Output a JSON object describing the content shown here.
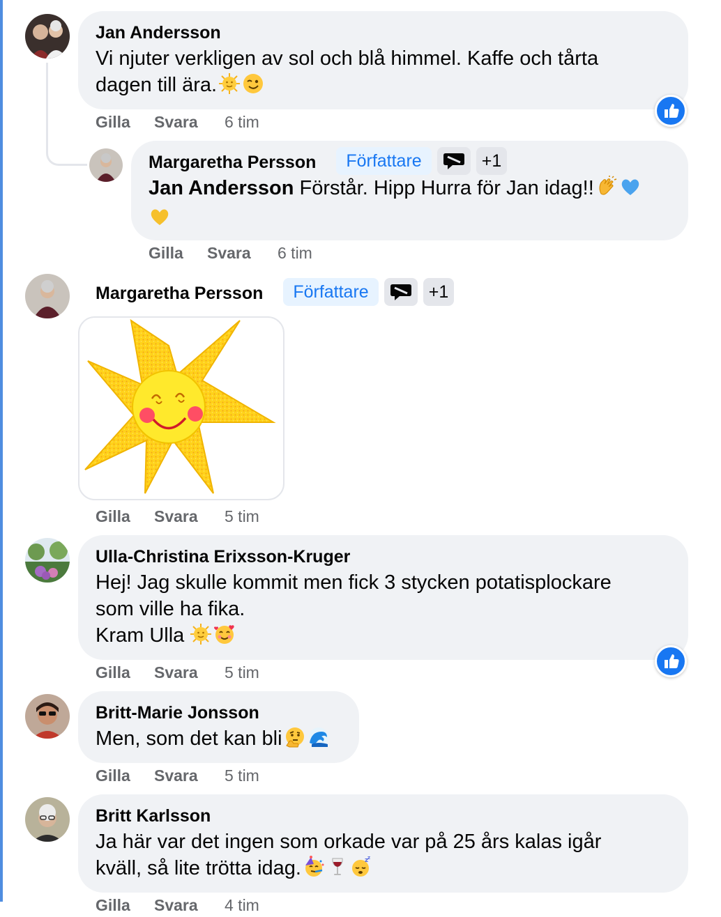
{
  "comments": [
    {
      "author": "Jan Andersson",
      "lines": [
        "Vi njuter verkligen av sol och blå himmel. Kaffe och tårta",
        "dagen till ära."
      ],
      "emoji_names": [
        "sun-face-emoji",
        "winking-face-emoji"
      ],
      "actions": {
        "like": "Gilla",
        "reply": "Svara",
        "time": "6 tim"
      },
      "reaction": "like"
    },
    {
      "author": "Margaretha Persson",
      "author_badge": "Författare",
      "extra_badge_count": "+1",
      "mention": "Jan Andersson",
      "lines": [
        " Förstår. Hipp Hurra för Jan idag!!"
      ],
      "emoji_names": [
        "clapping-hands-emoji",
        "blue-heart-emoji",
        "yellow-heart-emoji"
      ],
      "actions": {
        "like": "Gilla",
        "reply": "Svara",
        "time": "6 tim"
      }
    },
    {
      "author": "Margaretha Persson",
      "author_badge": "Författare",
      "extra_badge_count": "+1",
      "sticker": "smiling-sun-sticker",
      "actions": {
        "like": "Gilla",
        "reply": "Svara",
        "time": "5 tim"
      }
    },
    {
      "author": "Ulla-Christina Erixsson-Kruger",
      "lines": [
        "Hej! Jag skulle kommit men fick 3 stycken potatisplockare",
        "som ville ha fika.",
        "Kram Ulla"
      ],
      "emoji_names": [
        "sun-face-emoji",
        "smiling-face-with-hearts-emoji"
      ],
      "actions": {
        "like": "Gilla",
        "reply": "Svara",
        "time": "5 tim"
      },
      "reaction": "like"
    },
    {
      "author": "Britt-Marie Jonsson",
      "lines": [
        "Men, som det kan bli"
      ],
      "emoji_names": [
        "thinking-face-emoji",
        "wave-emoji"
      ],
      "actions": {
        "like": "Gilla",
        "reply": "Svara",
        "time": "5 tim"
      }
    },
    {
      "author": "Britt Karlsson",
      "lines": [
        "Ja här var det ingen som orkade var på 25 års kalas igår",
        "kväll, så lite trötta idag."
      ],
      "emoji_names": [
        "partying-face-emoji",
        "wine-glass-emoji",
        "sleeping-face-emoji"
      ],
      "actions": {
        "like": "Gilla",
        "reply": "Svara",
        "time": "4 tim"
      }
    }
  ],
  "colors": {
    "bubble": "#f0f2f5",
    "action_text": "#65676b",
    "author_badge_bg": "#e7f3ff",
    "author_badge_text": "#1877f2",
    "like_blue": "#1877f2",
    "left_rail": "#4f8de0"
  }
}
